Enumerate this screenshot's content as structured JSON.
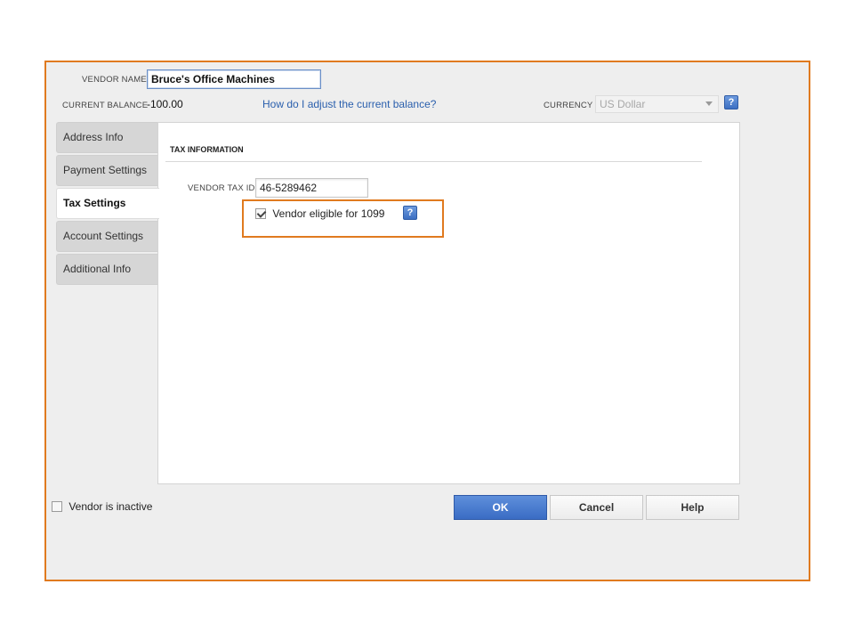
{
  "header": {
    "vendor_name_label": "VENDOR NAME",
    "vendor_name_value": "Bruce's Office Machines",
    "current_balance_label": "CURRENT BALANCE",
    "current_balance_value": "-100.00",
    "adjust_balance_link": "How do I adjust the current balance?",
    "currency_label": "CURRENCY",
    "currency_value": "US Dollar",
    "help_glyph": "?"
  },
  "tabs": [
    {
      "label": "Address Info",
      "active": false
    },
    {
      "label": "Payment Settings",
      "active": false
    },
    {
      "label": "Tax Settings",
      "active": true
    },
    {
      "label": "Account Settings",
      "active": false
    },
    {
      "label": "Additional Info",
      "active": false
    }
  ],
  "tax_section": {
    "heading": "TAX INFORMATION",
    "tax_id_label": "VENDOR TAX ID",
    "tax_id_value": "46-5289462",
    "eligible_1099_label": "Vendor eligible for 1099",
    "eligible_1099_checked": true
  },
  "footer": {
    "inactive_label": "Vendor is inactive",
    "inactive_checked": false,
    "ok_label": "OK",
    "cancel_label": "Cancel",
    "help_label": "Help"
  },
  "colors": {
    "highlight": "#e07a1f",
    "primary_button": "#3a6cc4",
    "link": "#2a5fad"
  }
}
